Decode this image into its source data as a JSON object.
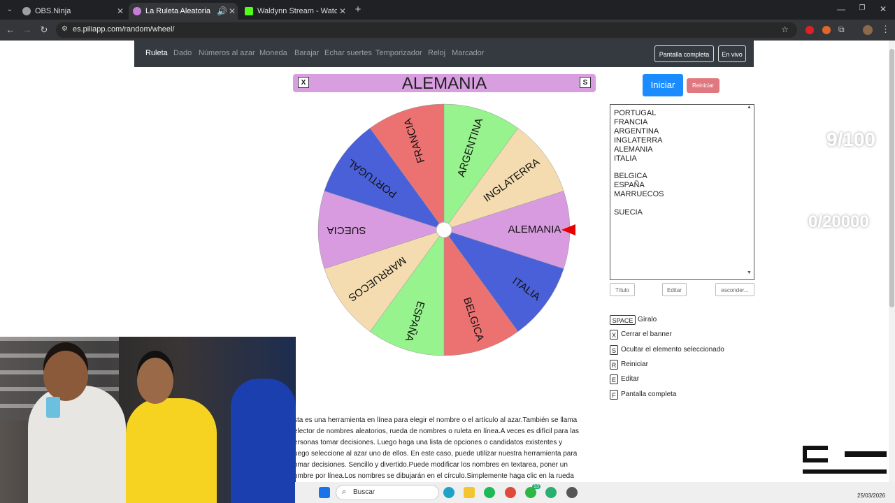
{
  "browser": {
    "tabs": [
      {
        "title": "OBS.Ninja",
        "icon_color": "#9aa0a6"
      },
      {
        "title": "La Ruleta Aleatoria",
        "icon_color": "#c77dd8"
      },
      {
        "title": "Waldynn Stream - Watch Live o",
        "icon_color": "#53fc18"
      }
    ],
    "url": "es.piliapp.com/random/wheel/"
  },
  "nav": {
    "items": [
      "Ruleta",
      "Dado",
      "Números al azar",
      "Moneda",
      "Barajar",
      "Echar suertes",
      "Temporizador",
      "Reloj",
      "Marcador"
    ],
    "fullscreen_label": "Pantalla completa",
    "live_label": "En vivo"
  },
  "wheel": {
    "title": "ALEMANIA",
    "close_key": "X",
    "hide_key": "S",
    "segments": [
      {
        "label": "ALEMANIA",
        "color": "#d99be0"
      },
      {
        "label": "ITALIA",
        "color": "#4a60d8"
      },
      {
        "label": "BELGICA",
        "color": "#ec7272"
      },
      {
        "label": "ESPAÑA",
        "color": "#97f38e"
      },
      {
        "label": "MARRUECOS",
        "color": "#f4dcb0"
      },
      {
        "label": "SUECIA",
        "color": "#d99be0"
      },
      {
        "label": "PORTUGAL",
        "color": "#4a60d8"
      },
      {
        "label": "FRANCIA",
        "color": "#ec7272"
      },
      {
        "label": "ARGENTINA",
        "color": "#97f38e"
      },
      {
        "label": "INGLATERRA",
        "color": "#f4dcb0"
      }
    ],
    "pointer_color": "#e80000"
  },
  "controls": {
    "start_label": "Iniciar",
    "reset_label": "Reiniciar",
    "title_label": "Título",
    "edit_label": "Editar",
    "hide_label": "esconder..."
  },
  "textarea_lines": [
    "PORTUGAL",
    "FRANCIA",
    "ARGENTINA",
    "INGLATERRA",
    "ALEMANIA",
    "ITALIA",
    "",
    "BELGICA",
    "ESPAÑA",
    "MARRUECOS",
    "",
    "SUECIA"
  ],
  "shortcuts": [
    {
      "key": "SPACE",
      "text": "Gíralo"
    },
    {
      "key": "X",
      "text": "Cerrar el banner"
    },
    {
      "key": "S",
      "text": "Ocultar el elemento seleccionado"
    },
    {
      "key": "R",
      "text": "Reiniciar"
    },
    {
      "key": "E",
      "text": "Editar"
    },
    {
      "key": "F",
      "text": "Pantalla completa"
    }
  ],
  "description_lines": [
    "sta es una herramienta en línea para elegir el nombre o el artículo al azar.También se llama",
    "elector de nombres aleatorios, rueda de nombres o ruleta en línea.A veces es difícil para las",
    "ersonas tomar decisiones. Luego haga una lista de opciones o candidatos existentes y",
    "uego seleccione al azar uno de ellos. En este caso, puede utilizar nuestra herramienta para",
    "omar decisiones. Sencillo y divertido.Puede modificar los nombres en textarea, poner un",
    "ombre por línea.Los nombres se dibujarán en el círculo.Simplemente haga clic en la rueda"
  ],
  "overlay": {
    "counter1": "9/100",
    "counter2": "0/20000"
  },
  "taskbar": {
    "search_label": "Buscar",
    "date": "25/03/2026",
    "notification_count": "13"
  }
}
